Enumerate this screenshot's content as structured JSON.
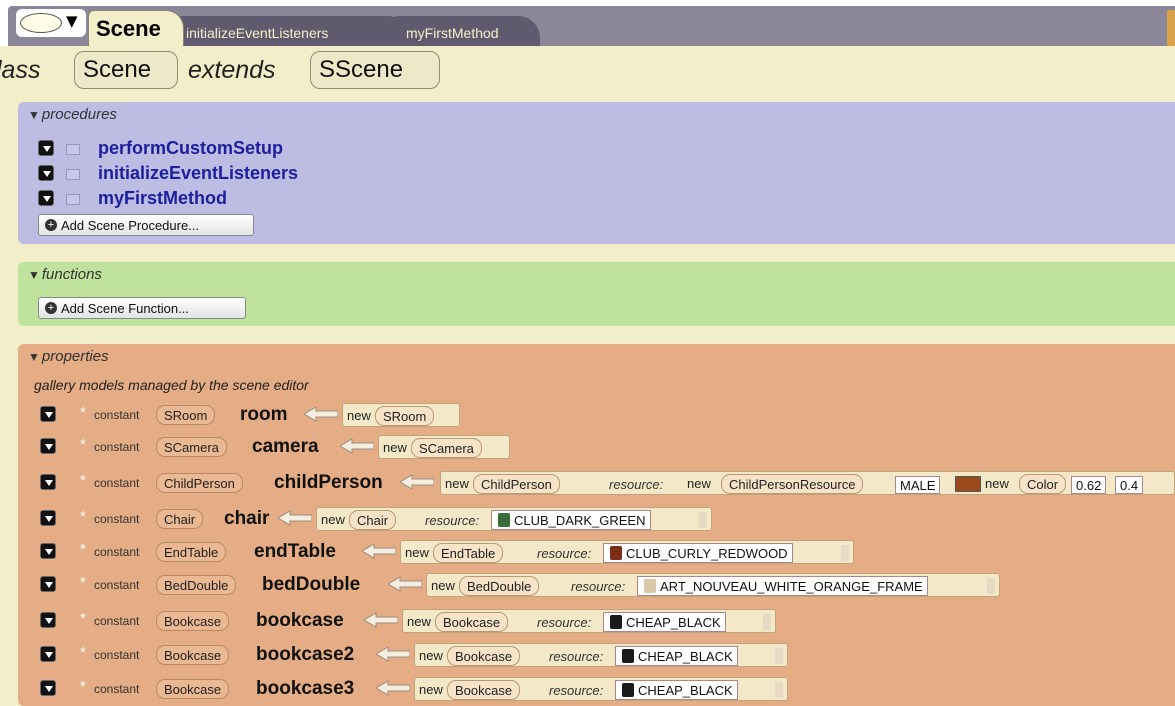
{
  "tabs": {
    "active": "Scene",
    "items": [
      "initializeEventListeners",
      "myFirstMethod"
    ]
  },
  "class_header": {
    "prefix": "lass",
    "class_name": "Scene",
    "extends_kw": "extends",
    "super_class": "SScene"
  },
  "procedures": {
    "title": "procedures",
    "items": [
      "performCustomSetup",
      "initializeEventListeners",
      "myFirstMethod"
    ],
    "add_label": "Add Scene Procedure..."
  },
  "functions": {
    "title": "functions",
    "add_label": "Add Scene Function..."
  },
  "properties": {
    "title": "properties",
    "note": "gallery models managed by the scene editor",
    "constant_kw": "constant",
    "new_kw": "new",
    "resource_kw": "resource:",
    "rows": [
      {
        "type": "SRoom",
        "name": "room",
        "ctor": "SRoom"
      },
      {
        "type": "SCamera",
        "name": "camera",
        "ctor": "SCamera"
      },
      {
        "type": "ChildPerson",
        "name": "childPerson",
        "ctor": "ChildPerson",
        "resource_ctor": "ChildPersonResource",
        "gender": "MALE",
        "color_ctor": "Color",
        "r": "0.62",
        "g": "0.4"
      },
      {
        "type": "Chair",
        "name": "chair",
        "ctor": "Chair",
        "resource": "CLUB_DARK_GREEN"
      },
      {
        "type": "EndTable",
        "name": "endTable",
        "ctor": "EndTable",
        "resource": "CLUB_CURLY_REDWOOD"
      },
      {
        "type": "BedDouble",
        "name": "bedDouble",
        "ctor": "BedDouble",
        "resource": "ART_NOUVEAU_WHITE_ORANGE_FRAME"
      },
      {
        "type": "Bookcase",
        "name": "bookcase",
        "ctor": "Bookcase",
        "resource": "CHEAP_BLACK"
      },
      {
        "type": "Bookcase",
        "name": "bookcase2",
        "ctor": "Bookcase",
        "resource": "CHEAP_BLACK"
      },
      {
        "type": "Bookcase",
        "name": "bookcase3",
        "ctor": "Bookcase",
        "resource": "CHEAP_BLACK"
      }
    ]
  },
  "colors": {
    "procedures_bg": "#bdbde3",
    "functions_bg": "#bfe39d",
    "properties_bg": "#e5ad85",
    "procedure_name": "#1d1f9c"
  }
}
